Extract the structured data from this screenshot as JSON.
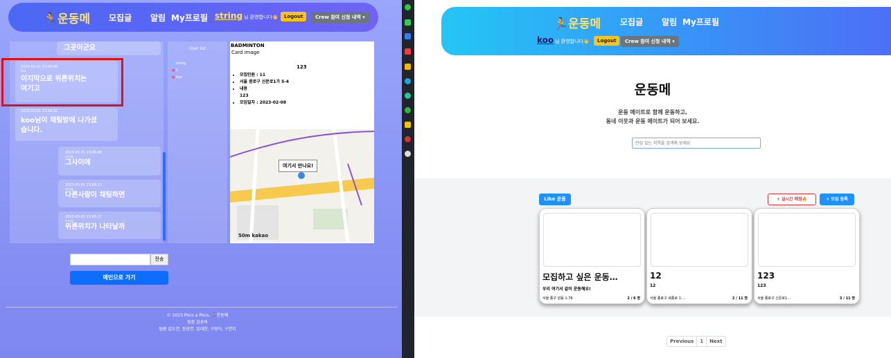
{
  "left": {
    "nav": {
      "logo": "🏃운동메",
      "links": [
        "모집글",
        "알림",
        "My프로필"
      ],
      "user": "string",
      "greet": "님 환영합니다👋",
      "logout": "Logout",
      "crew": "Crew 참여 신청 내역 ▾"
    },
    "messages": [
      {
        "time": "",
        "who": "",
        "text": "그곳이군요"
      },
      {
        "time": "2023-03-01 23:04:00",
        "who": "koo",
        "text": "이지막으로 위른위치는 여기고"
      },
      {
        "time": "2023-03-01 23:04:32",
        "who": "",
        "text": "koo님이 채팅방에 나가셨습니다."
      },
      {
        "time": "2023-03-01 23:06:08",
        "who": "string",
        "text": "그사이에"
      },
      {
        "time": "2023-03-01 23:06:11",
        "who": "string",
        "text": "다른사람이 채팅하면"
      },
      {
        "time": "2023-03-01 23:06:17",
        "who": "string",
        "text": "위른위치가 나타날까"
      }
    ],
    "userlist": {
      "title": "User list",
      "users": [
        "string",
        "1",
        "koo"
      ]
    },
    "detail": {
      "category": "BADMINTON",
      "img_alt": "Card image",
      "title": "123",
      "items": [
        "모집인원 : 11",
        "서울 종로구 신문로1가 5-4",
        "내용",
        "123",
        "모임일자 : 2023-02-08"
      ],
      "map_label": "여기서 만나요!",
      "map_brand": "50m kakao"
    },
    "send_label": "전송",
    "send_placeholder": "",
    "main_button": "메인으로 가기",
    "footer": [
      "© 2023 Poco a Poco, 🏃운동메",
      "팀장 김승비",
      "팀원 김도연, 정상연, 임대한, 구형딕, 구연지"
    ]
  },
  "right": {
    "nav": {
      "logo": "🏃운동메",
      "links": [
        "모집글",
        "알림",
        "My프로필"
      ],
      "user": "koo",
      "greet": "님 환영합니다👋",
      "logout": "Logout",
      "crew": "Crew 참여 신청 내역 ▾"
    },
    "hero_title": "운동메",
    "hero_sub1": "운동 메이트로 함께 운동하고,",
    "hero_sub2": "동네 이웃과 운동 메이트가 되어 보세요.",
    "search_placeholder": "관심 있는 지역을 검색해 보세요",
    "like_btn": "Like 운동",
    "live_btn": "+ 실시간 매칭🔥",
    "post_btn": "+ 모임 등록",
    "cards": [
      {
        "title": "모집하고 싶은 운동…",
        "desc": "우리 여기서 같이 운동해요!",
        "addr": "서울 종구 원동 1-76",
        "count": "2 / 6 명"
      },
      {
        "title": "12",
        "desc": "12",
        "addr": "서울 종로구 세종로 1-…",
        "count": "2 / 11 명"
      },
      {
        "title": "123",
        "desc": "123",
        "addr": "서울 종로구 신문로1…",
        "count": "3 / 11 명"
      }
    ],
    "pager": {
      "prev": "Previous",
      "page": "1",
      "next": "Next"
    }
  }
}
